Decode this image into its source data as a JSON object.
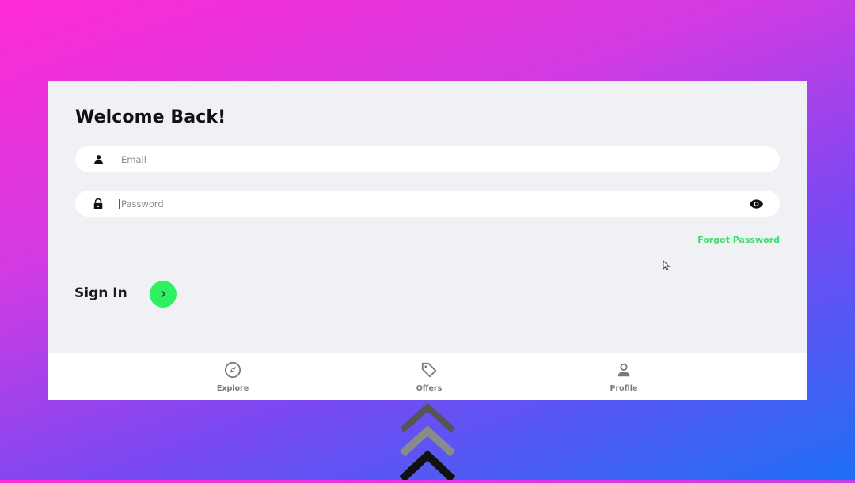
{
  "header": {
    "title": "Welcome Back!"
  },
  "form": {
    "email": {
      "placeholder": "Email",
      "value": ""
    },
    "password": {
      "placeholder": "Password",
      "value": ""
    },
    "forgot_label": "Forgot Password",
    "signin_label": "Sign In"
  },
  "bottom_nav": {
    "items": [
      {
        "label": "Explore",
        "icon": "compass-icon"
      },
      {
        "label": "Offers",
        "icon": "tag-icon"
      },
      {
        "label": "Profile",
        "icon": "person-icon"
      }
    ]
  },
  "colors": {
    "accent": "#2ff061",
    "link": "#3dde6e",
    "panel_bg": "#f0f1f5",
    "nav_label": "#7a7a7a"
  }
}
